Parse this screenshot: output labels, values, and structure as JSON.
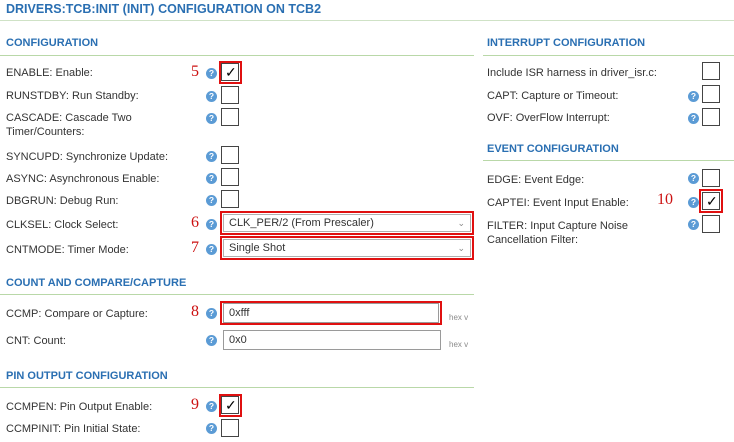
{
  "title": "DRIVERS:TCB:INIT (INIT) CONFIGURATION ON TCB2",
  "sections": {
    "configuration": "CONFIGURATION",
    "count_compare": "COUNT AND COMPARE/CAPTURE",
    "pin_output": "PIN OUTPUT CONFIGURATION",
    "interrupt": "INTERRUPT CONFIGURATION",
    "event": "EVENT CONFIGURATION"
  },
  "help_glyph": "?",
  "check_glyph": "✓",
  "configuration": {
    "enable": {
      "label": "ENABLE: Enable:",
      "checked": true
    },
    "runstdby": {
      "label": "RUNSTDBY: Run Standby:",
      "checked": false
    },
    "cascade": {
      "label": "CASCADE: Cascade Two Timer/Counters:",
      "checked": false
    },
    "syncupd": {
      "label": "SYNCUPD: Synchronize Update:",
      "checked": false
    },
    "async": {
      "label": "ASYNC: Asynchronous Enable:",
      "checked": false
    },
    "dbgrun": {
      "label": "DBGRUN: Debug Run:",
      "checked": false
    },
    "clksel": {
      "label": "CLKSEL: Clock Select:",
      "value": "CLK_PER/2 (From Prescaler)"
    },
    "cntmode": {
      "label": "CNTMODE: Timer Mode:",
      "value": "Single Shot"
    }
  },
  "count": {
    "ccmp": {
      "label": "CCMP: Compare or Capture:",
      "value": "0xfff",
      "unit": "hex v"
    },
    "cnt": {
      "label": "CNT: Count:",
      "value": "0x0",
      "unit": "hex v"
    }
  },
  "pin": {
    "ccmpen": {
      "label": "CCMPEN: Pin Output Enable:",
      "checked": true
    },
    "ccmpinit": {
      "label": "CCMPINIT: Pin Initial State:",
      "checked": false
    }
  },
  "interrupt": {
    "isr": {
      "label": "Include ISR harness in driver_isr.c:",
      "checked": false
    },
    "capt": {
      "label": "CAPT: Capture or Timeout:",
      "checked": false
    },
    "ovf": {
      "label": "OVF: OverFlow Interrupt:",
      "checked": false
    }
  },
  "event": {
    "edge": {
      "label": "EDGE: Event Edge:",
      "checked": false
    },
    "captei": {
      "label": "CAPTEI: Event Input Enable:",
      "checked": true
    },
    "filter": {
      "label": "FILTER: Input Capture Noise Cancellation Filter:",
      "checked": false
    }
  },
  "annotations": {
    "n5": "5",
    "n6": "6",
    "n7": "7",
    "n8": "8",
    "n9": "9",
    "n10": "10"
  },
  "colors": {
    "accent": "#2a6fb2",
    "help": "#5b9bd5",
    "highlight": "#e01010",
    "rule": "#b9d8a8"
  }
}
